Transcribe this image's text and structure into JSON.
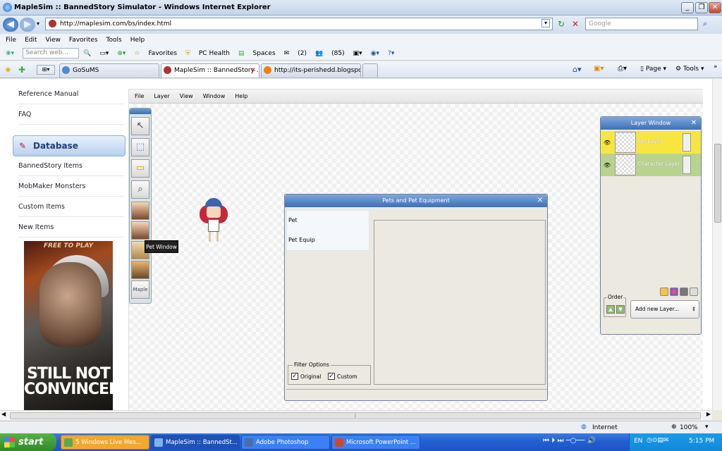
{
  "browser": {
    "title": "MapleSim :: BannedStory Simulator - Windows Internet Explorer",
    "url": "http://maplesim.com/bs/index.html",
    "search_placeholder": "Google",
    "menu": [
      "File",
      "Edit",
      "View",
      "Favorites",
      "Tools",
      "Help"
    ],
    "toolbar": {
      "search_placeholder": "Search web...",
      "favorites": "Favorites",
      "pc_health": "PC Health",
      "spaces": "Spaces",
      "mail_count": "(2)",
      "people_count": "(85)"
    },
    "tabs": [
      {
        "label": "GoSuMS"
      },
      {
        "label": "MapleSim :: BannedStory ..."
      },
      {
        "label": "http://its-perishedd.blogspot..."
      }
    ],
    "command_bar": {
      "page": "Page",
      "tools": "Tools"
    }
  },
  "sidebar": {
    "links_top": [
      "Reference Manual",
      "FAQ"
    ],
    "database_label": "Database",
    "links": [
      "BannedStory Items",
      "MobMaker Monsters",
      "Custom Items",
      "New Items"
    ],
    "ad": {
      "top_text": "FREE TO PLAY",
      "headline": "STILL NOT CONVINCED?"
    }
  },
  "app": {
    "menu": [
      "File",
      "Layer",
      "View",
      "Window",
      "Help"
    ],
    "tooltip": "Pet Window",
    "tool_label_last": "Maple"
  },
  "pet_dialog": {
    "title": "Pets and Pet Equipment",
    "items": [
      "Pet",
      "Pet Equip"
    ],
    "filter_legend": "Filter Options",
    "filter_original": "Original",
    "filter_custom": "Custom"
  },
  "layer_window": {
    "title": "Layer Window",
    "layers": [
      {
        "name": "Pet Layer",
        "color": "#f7e642"
      },
      {
        "name": "Character Layer",
        "color": "#b8d48c"
      }
    ],
    "order_legend": "Order",
    "add_new_layer": "Add new Layer..."
  },
  "status": {
    "zone": "Internet",
    "zoom": "100%"
  },
  "taskbar": {
    "start": "start",
    "tasks": [
      "5 Windows Live Mes...",
      "MapleSim :: BannedSt...",
      "Adobe Photoshop",
      "Microsoft PowerPoint ..."
    ],
    "language": "EN",
    "time": "5:15 PM"
  },
  "colors": {
    "accent": "#3d6fb7",
    "taskbar": "#235fd0",
    "start": "#3a9a30"
  }
}
